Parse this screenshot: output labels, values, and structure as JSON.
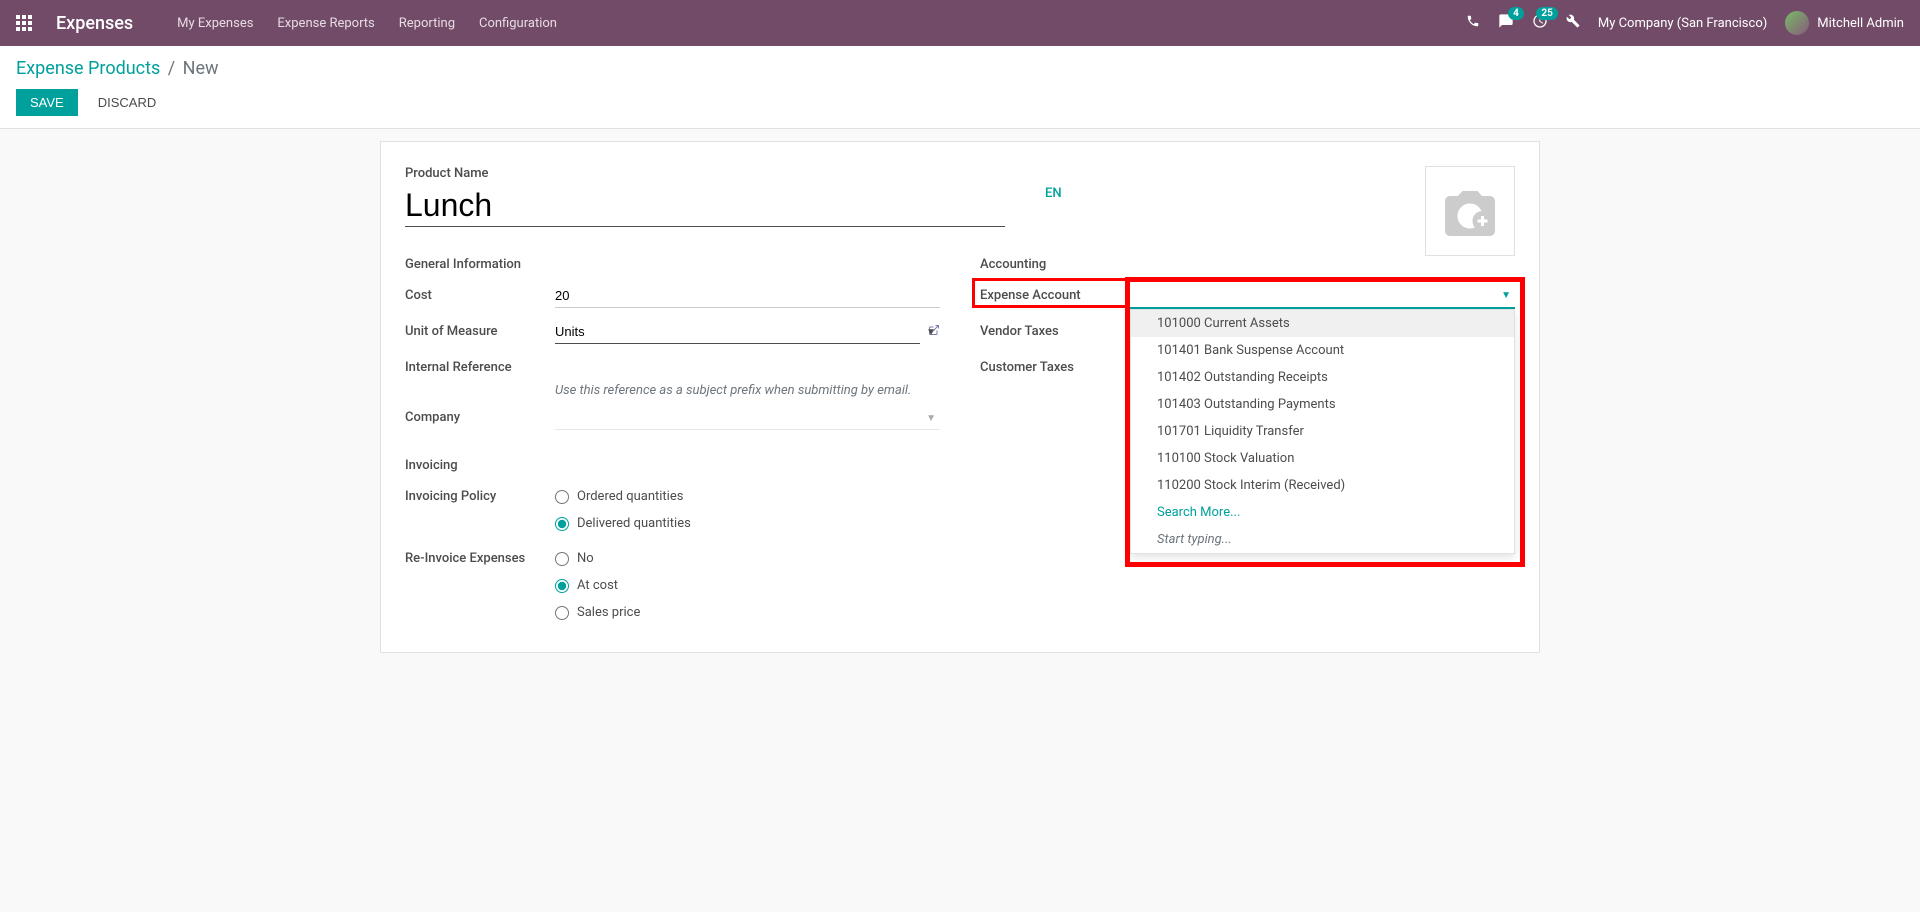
{
  "navbar": {
    "app_title": "Expenses",
    "menu": [
      "My Expenses",
      "Expense Reports",
      "Reporting",
      "Configuration"
    ],
    "messages_badge": "4",
    "activities_badge": "25",
    "company": "My Company (San Francisco)",
    "user": "Mitchell Admin"
  },
  "breadcrumb": {
    "parent": "Expense Products",
    "current": "New"
  },
  "buttons": {
    "save": "Save",
    "discard": "Discard"
  },
  "form": {
    "product_name_label": "Product Name",
    "product_name_value": "Lunch",
    "lang": "EN",
    "sections": {
      "general": "General Information",
      "accounting": "Accounting",
      "invoicing": "Invoicing"
    },
    "fields": {
      "cost_label": "Cost",
      "cost_value": "20",
      "uom_label": "Unit of Measure",
      "uom_value": "Units",
      "internal_ref_label": "Internal Reference",
      "internal_ref_help": "Use this reference as a subject prefix when submitting by email.",
      "company_label": "Company",
      "company_value": "",
      "invoicing_policy_label": "Invoicing Policy",
      "invoicing_policy_options": {
        "ordered": "Ordered quantities",
        "delivered": "Delivered quantities"
      },
      "reinvoice_label": "Re-Invoice Expenses",
      "reinvoice_options": {
        "no": "No",
        "at_cost": "At cost",
        "sales_price": "Sales price"
      },
      "expense_account_label": "Expense Account",
      "vendor_taxes_label": "Vendor Taxes",
      "customer_taxes_label": "Customer Taxes"
    },
    "dropdown": {
      "options": [
        "101000 Current Assets",
        "101401 Bank Suspense Account",
        "101402 Outstanding Receipts",
        "101403 Outstanding Payments",
        "101701 Liquidity Transfer",
        "110100 Stock Valuation",
        "110200 Stock Interim (Received)"
      ],
      "search_more": "Search More...",
      "start_typing": "Start typing..."
    }
  }
}
